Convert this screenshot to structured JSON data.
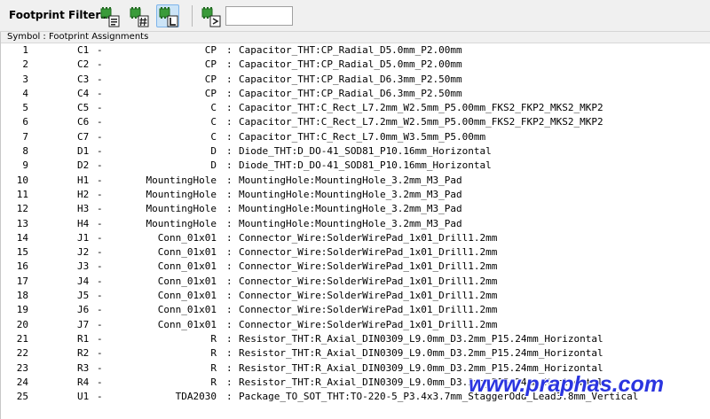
{
  "toolbar": {
    "label": "Footprint Filters:",
    "filter_value": ""
  },
  "list": {
    "header": "Symbol : Footprint Assignments",
    "rows": [
      {
        "num": "1",
        "ref": "C1",
        "value": "CP",
        "footprint": "Capacitor_THT:CP_Radial_D5.0mm_P2.00mm"
      },
      {
        "num": "2",
        "ref": "C2",
        "value": "CP",
        "footprint": "Capacitor_THT:CP_Radial_D5.0mm_P2.00mm"
      },
      {
        "num": "3",
        "ref": "C3",
        "value": "CP",
        "footprint": "Capacitor_THT:CP_Radial_D6.3mm_P2.50mm"
      },
      {
        "num": "4",
        "ref": "C4",
        "value": "CP",
        "footprint": "Capacitor_THT:CP_Radial_D6.3mm_P2.50mm"
      },
      {
        "num": "5",
        "ref": "C5",
        "value": "C",
        "footprint": "Capacitor_THT:C_Rect_L7.2mm_W2.5mm_P5.00mm_FKS2_FKP2_MKS2_MKP2"
      },
      {
        "num": "6",
        "ref": "C6",
        "value": "C",
        "footprint": "Capacitor_THT:C_Rect_L7.2mm_W2.5mm_P5.00mm_FKS2_FKP2_MKS2_MKP2"
      },
      {
        "num": "7",
        "ref": "C7",
        "value": "C",
        "footprint": "Capacitor_THT:C_Rect_L7.0mm_W3.5mm_P5.00mm"
      },
      {
        "num": "8",
        "ref": "D1",
        "value": "D",
        "footprint": "Diode_THT:D_DO-41_SOD81_P10.16mm_Horizontal"
      },
      {
        "num": "9",
        "ref": "D2",
        "value": "D",
        "footprint": "Diode_THT:D_DO-41_SOD81_P10.16mm_Horizontal"
      },
      {
        "num": "10",
        "ref": "H1",
        "value": "MountingHole",
        "footprint": "MountingHole:MountingHole_3.2mm_M3_Pad"
      },
      {
        "num": "11",
        "ref": "H2",
        "value": "MountingHole",
        "footprint": "MountingHole:MountingHole_3.2mm_M3_Pad"
      },
      {
        "num": "12",
        "ref": "H3",
        "value": "MountingHole",
        "footprint": "MountingHole:MountingHole_3.2mm_M3_Pad"
      },
      {
        "num": "13",
        "ref": "H4",
        "value": "MountingHole",
        "footprint": "MountingHole:MountingHole_3.2mm_M3_Pad"
      },
      {
        "num": "14",
        "ref": "J1",
        "value": "Conn_01x01",
        "footprint": "Connector_Wire:SolderWirePad_1x01_Drill1.2mm"
      },
      {
        "num": "15",
        "ref": "J2",
        "value": "Conn_01x01",
        "footprint": "Connector_Wire:SolderWirePad_1x01_Drill1.2mm"
      },
      {
        "num": "16",
        "ref": "J3",
        "value": "Conn_01x01",
        "footprint": "Connector_Wire:SolderWirePad_1x01_Drill1.2mm"
      },
      {
        "num": "17",
        "ref": "J4",
        "value": "Conn_01x01",
        "footprint": "Connector_Wire:SolderWirePad_1x01_Drill1.2mm"
      },
      {
        "num": "18",
        "ref": "J5",
        "value": "Conn_01x01",
        "footprint": "Connector_Wire:SolderWirePad_1x01_Drill1.2mm"
      },
      {
        "num": "19",
        "ref": "J6",
        "value": "Conn_01x01",
        "footprint": "Connector_Wire:SolderWirePad_1x01_Drill1.2mm"
      },
      {
        "num": "20",
        "ref": "J7",
        "value": "Conn_01x01",
        "footprint": "Connector_Wire:SolderWirePad_1x01_Drill1.2mm"
      },
      {
        "num": "21",
        "ref": "R1",
        "value": "R",
        "footprint": "Resistor_THT:R_Axial_DIN0309_L9.0mm_D3.2mm_P15.24mm_Horizontal"
      },
      {
        "num": "22",
        "ref": "R2",
        "value": "R",
        "footprint": "Resistor_THT:R_Axial_DIN0309_L9.0mm_D3.2mm_P15.24mm_Horizontal"
      },
      {
        "num": "23",
        "ref": "R3",
        "value": "R",
        "footprint": "Resistor_THT:R_Axial_DIN0309_L9.0mm_D3.2mm_P15.24mm_Horizontal"
      },
      {
        "num": "24",
        "ref": "R4",
        "value": "R",
        "footprint": "Resistor_THT:R_Axial_DIN0309_L9.0mm_D3.2mm_P15.24mm_Horizontal"
      },
      {
        "num": "25",
        "ref": "U1",
        "value": "TDA2030",
        "footprint": "Package_TO_SOT_THT:TO-220-5_P3.4x3.7mm_StaggerOdd_Lead3.8mm_Vertical"
      }
    ]
  },
  "watermark": "www.praphas.com",
  "icons": {
    "filter_keywords": "filter-keywords-icon",
    "filter_pin_count": "filter-pin-count-icon",
    "filter_library": "filter-library-icon",
    "filter_text": "filter-text-icon"
  },
  "colors": {
    "toolbar_bg": "#f0f0f0",
    "active_button_bg": "#cce4f7",
    "icon_green": "#3a9b3a",
    "watermark": "#2b35e0"
  }
}
